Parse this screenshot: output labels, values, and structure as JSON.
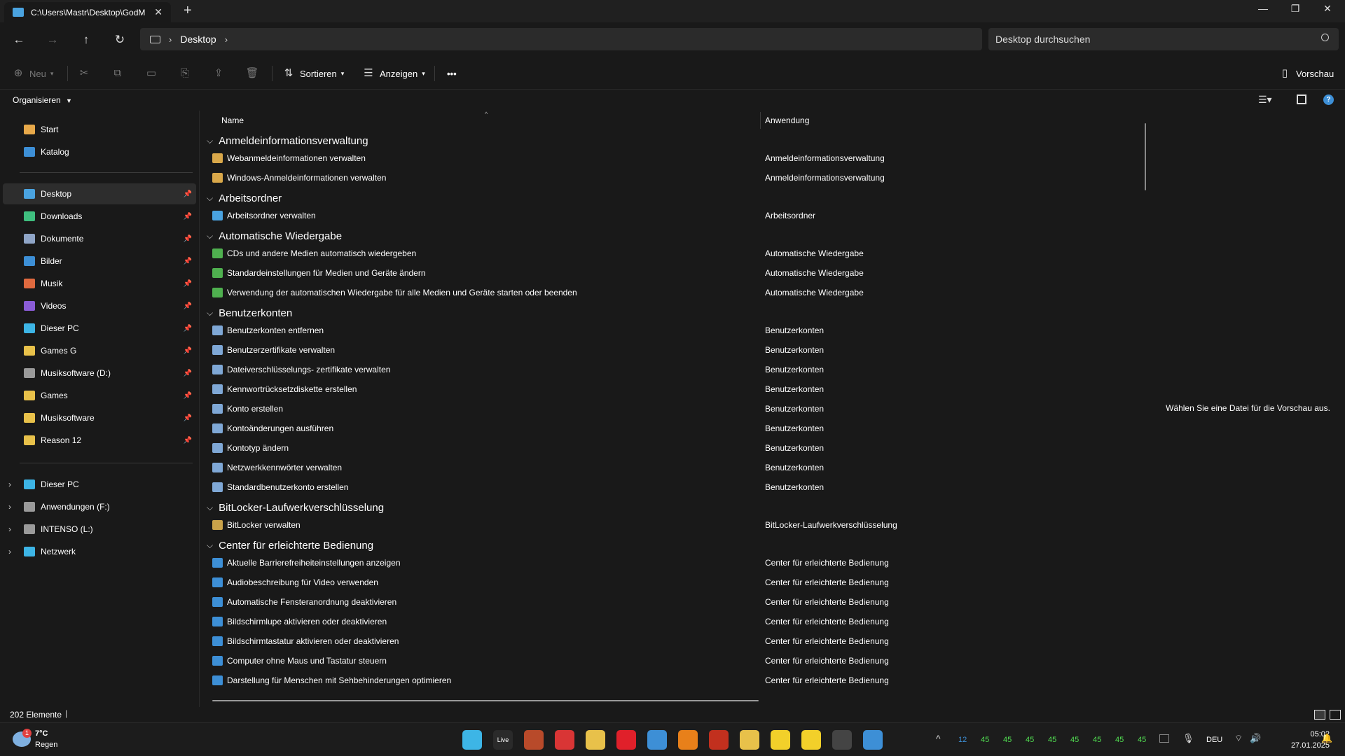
{
  "window": {
    "tab_title": "C:\\Users\\Mastr\\Desktop\\GodM",
    "icons": {
      "close": "close-icon",
      "new_tab": "plus-icon",
      "minimize": "minimize-icon",
      "restore": "restore-icon",
      "window_close": "close-icon"
    }
  },
  "nav": {
    "breadcrumb": [
      "Desktop"
    ],
    "search_placeholder": "Desktop durchsuchen"
  },
  "toolbar": {
    "new_label": "Neu",
    "sort_label": "Sortieren",
    "view_label": "Anzeigen",
    "more_label": "•••",
    "preview_label": "Vorschau",
    "organize_label": "Organisieren"
  },
  "sidebar": {
    "top": [
      {
        "label": "Start",
        "color": "#e8a94a"
      },
      {
        "label": "Katalog",
        "color": "#3d8fd6"
      }
    ],
    "pinned": [
      {
        "label": "Desktop",
        "color": "#4aa3e0",
        "selected": true
      },
      {
        "label": "Downloads",
        "color": "#3fbf7f"
      },
      {
        "label": "Dokumente",
        "color": "#8fa5c7"
      },
      {
        "label": "Bilder",
        "color": "#3d8fd6"
      },
      {
        "label": "Musik",
        "color": "#e06a3f"
      },
      {
        "label": "Videos",
        "color": "#8a5cd6"
      },
      {
        "label": "Dieser PC",
        "color": "#3db5e6"
      },
      {
        "label": "Games G",
        "color": "#e8c14a"
      },
      {
        "label": "Musiksoftware (D:)",
        "color": "#9a9a9a"
      },
      {
        "label": "Games",
        "color": "#e8c14a"
      },
      {
        "label": "Musiksoftware",
        "color": "#e8c14a"
      },
      {
        "label": "Reason 12",
        "color": "#e8c14a"
      }
    ],
    "tree": [
      {
        "label": "Dieser PC",
        "color": "#3db5e6"
      },
      {
        "label": "Anwendungen (F:)",
        "color": "#9a9a9a"
      },
      {
        "label": "INTENSO (L:)",
        "color": "#9a9a9a"
      },
      {
        "label": "Netzwerk",
        "color": "#3db5e6"
      }
    ]
  },
  "columns": {
    "name": "Name",
    "app": "Anwendung"
  },
  "groups": [
    {
      "title": "Anmeldeinformationsverwaltung",
      "color": "#d9a84a",
      "rows": [
        {
          "name": "Webanmeldeinformationen verwalten",
          "app": "Anmeldeinformationsverwaltung"
        },
        {
          "name": "Windows-Anmeldeinformationen verwalten",
          "app": "Anmeldeinformationsverwaltung"
        }
      ]
    },
    {
      "title": "Arbeitsordner",
      "color": "#4aa3e0",
      "rows": [
        {
          "name": "Arbeitsordner verwalten",
          "app": "Arbeitsordner"
        }
      ]
    },
    {
      "title": "Automatische Wiedergabe",
      "color": "#4fb04f",
      "rows": [
        {
          "name": "CDs und andere Medien automatisch wiedergeben",
          "app": "Automatische Wiedergabe"
        },
        {
          "name": "Standardeinstellungen für Medien und Geräte ändern",
          "app": "Automatische Wiedergabe"
        },
        {
          "name": "Verwendung der automatischen Wiedergabe für alle Medien und Geräte starten oder beenden",
          "app": "Automatische Wiedergabe"
        }
      ]
    },
    {
      "title": "Benutzerkonten",
      "color": "#7fa8d6",
      "rows": [
        {
          "name": "Benutzerkonten entfernen",
          "app": "Benutzerkonten"
        },
        {
          "name": "Benutzerzertifikate verwalten",
          "app": "Benutzerkonten"
        },
        {
          "name": "Dateiverschlüsselungs- zertifikate verwalten",
          "app": "Benutzerkonten"
        },
        {
          "name": "Kennwortrücksetzdiskette erstellen",
          "app": "Benutzerkonten"
        },
        {
          "name": "Konto erstellen",
          "app": "Benutzerkonten"
        },
        {
          "name": "Kontoänderungen ausführen",
          "app": "Benutzerkonten"
        },
        {
          "name": "Kontotyp ändern",
          "app": "Benutzerkonten"
        },
        {
          "name": "Netzwerkkennwörter verwalten",
          "app": "Benutzerkonten"
        },
        {
          "name": "Standardbenutzerkonto erstellen",
          "app": "Benutzerkonten"
        }
      ]
    },
    {
      "title": "BitLocker-Laufwerkverschlüsselung",
      "color": "#c9a24a",
      "rows": [
        {
          "name": "BitLocker verwalten",
          "app": "BitLocker-Laufwerkverschlüsselung"
        }
      ]
    },
    {
      "title": "Center für erleichterte Bedienung",
      "color": "#3d8fd6",
      "rows": [
        {
          "name": "Aktuelle Barrierefreiheiteinstellungen anzeigen",
          "app": "Center für erleichterte Bedienung"
        },
        {
          "name": "Audiobeschreibung für Video verwenden",
          "app": "Center für erleichterte Bedienung"
        },
        {
          "name": "Automatische Fensteranordnung deaktivieren",
          "app": "Center für erleichterte Bedienung"
        },
        {
          "name": "Bildschirmlupe aktivieren oder deaktivieren",
          "app": "Center für erleichterte Bedienung"
        },
        {
          "name": "Bildschirmtastatur aktivieren oder deaktivieren",
          "app": "Center für erleichterte Bedienung"
        },
        {
          "name": "Computer ohne Maus und Tastatur steuern",
          "app": "Center für erleichterte Bedienung"
        },
        {
          "name": "Darstellung für Menschen mit Sehbehinderungen optimieren",
          "app": "Center für erleichterte Bedienung"
        }
      ]
    }
  ],
  "preview": {
    "message": "Wählen Sie eine Datei für die Vorschau aus."
  },
  "status": {
    "count": "202 Elemente"
  },
  "taskbar": {
    "weather_temp": "7°C",
    "weather_desc": "Regen",
    "weather_badge": "1",
    "tray_numbers": [
      "12",
      "45",
      "45",
      "45",
      "45",
      "45",
      "45",
      "45",
      "45"
    ],
    "language": "DEU",
    "time": "05:02",
    "date": "27.01.2025",
    "apps": [
      {
        "name": "windows-start-icon",
        "color": "#3db5e6"
      },
      {
        "name": "live-icon",
        "color": "#2a2a2a",
        "label": "Live"
      },
      {
        "name": "app-a-icon",
        "color": "#b84a2a"
      },
      {
        "name": "app-s-icon",
        "color": "#d93535"
      },
      {
        "name": "file-explorer-icon",
        "color": "#e8c14a"
      },
      {
        "name": "opera-icon",
        "color": "#e0202a"
      },
      {
        "name": "affinity-icon",
        "color": "#3d8fd6"
      },
      {
        "name": "blender-icon",
        "color": "#e8801a"
      },
      {
        "name": "app-red-icon",
        "color": "#c2301e"
      },
      {
        "name": "app-warning-icon",
        "color": "#e8c14a"
      },
      {
        "name": "app-yellow-icon",
        "color": "#f2d02a"
      },
      {
        "name": "app-yellow2-icon",
        "color": "#f2d02a"
      },
      {
        "name": "app-dark-icon",
        "color": "#444444"
      },
      {
        "name": "app-blue-icon",
        "color": "#3d8fd6"
      }
    ]
  }
}
